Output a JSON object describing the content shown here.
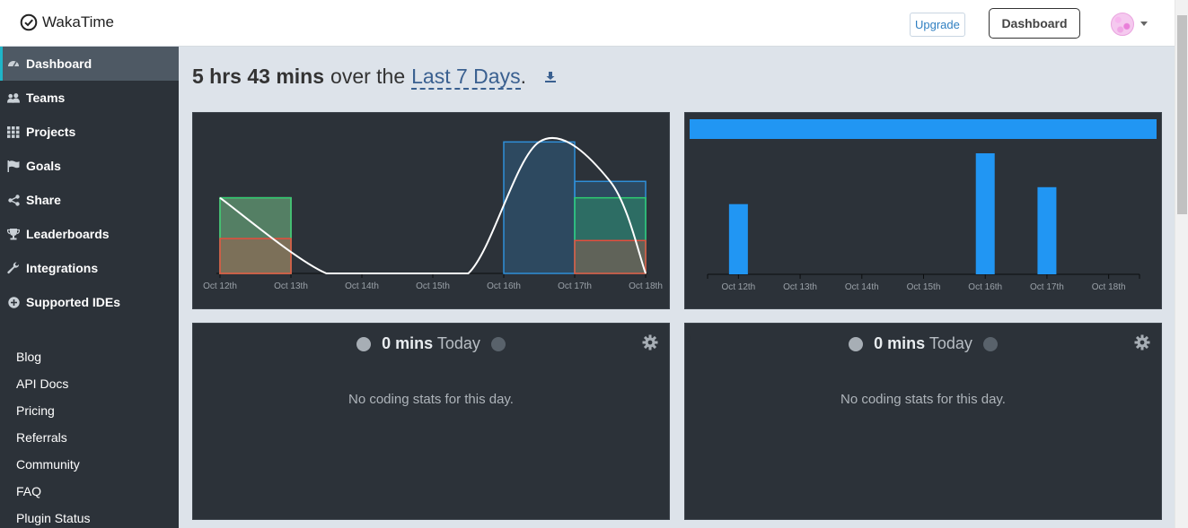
{
  "app": {
    "name": "WakaTime"
  },
  "header": {
    "upgrade_label": "Upgrade",
    "dashboard_label": "Dashboard"
  },
  "sidebar": {
    "items": [
      {
        "label": "Dashboard",
        "icon": "dashboard-icon",
        "active": true
      },
      {
        "label": "Teams",
        "icon": "users-icon"
      },
      {
        "label": "Projects",
        "icon": "grid-icon"
      },
      {
        "label": "Goals",
        "icon": "flag-icon"
      },
      {
        "label": "Share",
        "icon": "share-icon"
      },
      {
        "label": "Leaderboards",
        "icon": "trophy-icon"
      },
      {
        "label": "Integrations",
        "icon": "wrench-icon"
      },
      {
        "label": "Supported IDEs",
        "icon": "plus-circle-icon"
      }
    ],
    "links": [
      "Blog",
      "API Docs",
      "Pricing",
      "Referrals",
      "Community",
      "FAQ",
      "Plugin Status"
    ]
  },
  "summary": {
    "total": "5 hrs 43 mins",
    "mid": "over the",
    "range": "Last 7 Days",
    "period": "."
  },
  "colors": {
    "panel_bg": "#2c3239",
    "bar_blue": "#2196f3",
    "accent_teal": "#1fb5c8"
  },
  "chart_data": [
    {
      "type": "bar",
      "categories": [
        "Oct 12th",
        "Oct 13th",
        "Oct 14th",
        "Oct 15th",
        "Oct 16th",
        "Oct 17th",
        "Oct 18th"
      ],
      "series": [
        {
          "values": [
            0.53,
            0,
            0,
            0,
            0,
            0.5,
            0
          ],
          "color": "#e74c3c"
        },
        {
          "values": [
            1.15,
            0,
            0,
            0,
            0,
            1.15,
            0
          ],
          "color": "#2ecc71"
        },
        {
          "values": [
            1.15,
            0,
            0,
            0,
            2.0,
            1.4,
            0
          ],
          "color": "#2f8fd8"
        },
        {
          "values": [
            1.15,
            0,
            0,
            0,
            0,
            0,
            0
          ],
          "color": "#f0a060"
        }
      ],
      "curve": [
        1.15,
        0,
        0,
        0,
        2.0,
        1.4,
        0
      ],
      "ylim": [
        0,
        2.1
      ]
    },
    {
      "type": "bar",
      "categories": [
        "Oct 12th",
        "Oct 13th",
        "Oct 14th",
        "Oct 15th",
        "Oct 16th",
        "Oct 17th",
        "Oct 18th"
      ],
      "values": [
        0.58,
        0,
        0,
        0,
        1.0,
        0.72,
        0
      ],
      "ylim": [
        0,
        1.0
      ],
      "top_band": true
    }
  ],
  "panels": [
    {
      "total": "0 mins",
      "label": "Today",
      "empty": "No coding stats for this day."
    },
    {
      "total": "0 mins",
      "label": "Today",
      "empty": "No coding stats for this day."
    }
  ]
}
